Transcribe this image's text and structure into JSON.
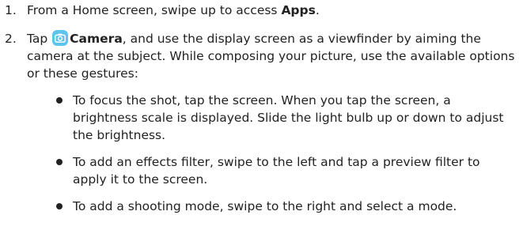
{
  "steps": [
    {
      "number": "1.",
      "prefix": "From a Home screen, swipe up to access ",
      "bold": "Apps",
      "suffix": "."
    },
    {
      "number": "2.",
      "prefix": "Tap ",
      "icon": "camera-app-icon",
      "bold": "Camera",
      "suffix": ", and use the display screen as a viewfinder by aiming the camera at the subject. While composing your picture, use the available options or these gestures:",
      "bullets": [
        "To focus the shot, tap the screen. When you tap the screen, a brightness scale is displayed. Slide the light bulb up or down to adjust the brightness.",
        "To add an effects filter, swipe to the left and tap a preview filter to apply it to the screen.",
        "To add a shooting mode, swipe to the right and select a mode."
      ]
    }
  ],
  "colors": {
    "text": "#222222",
    "camera_icon_bg": "#5ec4ec"
  }
}
